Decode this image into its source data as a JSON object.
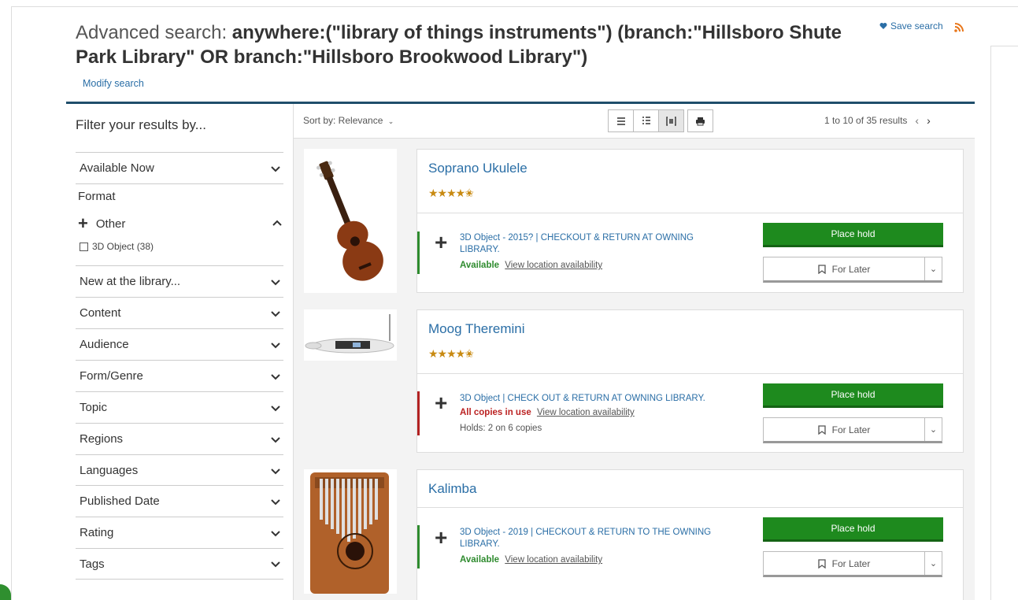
{
  "header": {
    "title_prefix": "Advanced search:",
    "title_query": "anywhere:(\"library of things instruments\") (branch:\"Hillsboro Shute Park Library\" OR branch:\"Hillsboro Brookwood Library\")",
    "save_search": "Save search",
    "modify_search": "Modify search"
  },
  "sidebar": {
    "title": "Filter your results by...",
    "available_now": "Available Now",
    "format_label": "Format",
    "other_label": "Other",
    "checkbox_label": "3D Object (38)",
    "facets": [
      "New at the library...",
      "Content",
      "Audience",
      "Form/Genre",
      "Topic",
      "Regions",
      "Languages",
      "Published Date",
      "Rating",
      "Tags"
    ]
  },
  "toolbar": {
    "sort": "Sort by: Relevance",
    "results": "1 to 10 of 35 results"
  },
  "results": [
    {
      "title": "Soprano Ukulele",
      "format": "3D Object - 2015? | CHECKOUT & RETURN AT OWNING LIBRARY.",
      "status": "Available",
      "location": "View location availability",
      "holds": "",
      "hold_button": "Place hold",
      "later_button": "For Later",
      "rating_stars": 4.5,
      "status_color": "#2e8b2e"
    },
    {
      "title": "Moog Theremini",
      "format": "3D Object | CHECK OUT & RETURN AT OWNING LIBRARY.",
      "status": "All copies in use",
      "location": "View location availability",
      "holds": "Holds: 2 on 6 copies",
      "hold_button": "Place hold",
      "later_button": "For Later",
      "rating_stars": 4.5,
      "status_color": "#b22222"
    },
    {
      "title": "Kalimba",
      "format": "3D Object - 2019 | CHECKOUT & RETURN TO THE OWNING LIBRARY.",
      "status": "Available",
      "location": "View location availability",
      "holds": "",
      "hold_button": "Place hold",
      "later_button": "For Later",
      "rating_stars": 0,
      "status_color": "#2e8b2e"
    }
  ],
  "colors": {
    "link": "#2a6ea6",
    "hold_green": "#1e8a1e",
    "rule": "#1f4e6b",
    "star": "#c88a12"
  }
}
